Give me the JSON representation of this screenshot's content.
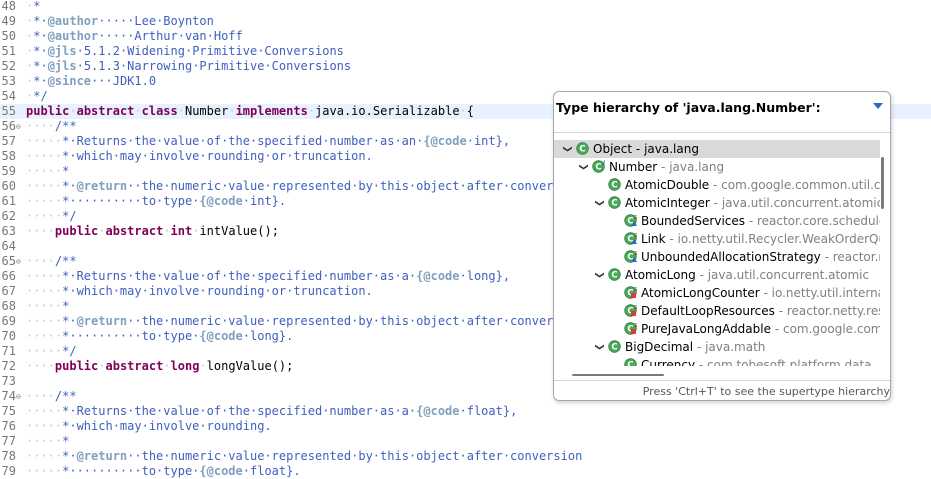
{
  "editor": {
    "lines": [
      {
        "n": "48",
        "t": " *"
      },
      {
        "n": "49",
        "t": " * @author     Lee Boynton"
      },
      {
        "n": "50",
        "t": " * @author     Arthur van Hoff"
      },
      {
        "n": "51",
        "t": " * @jls 5.1.2 Widening Primitive Conversions"
      },
      {
        "n": "52",
        "t": " * @jls 5.1.3 Narrowing Primitive Conversions"
      },
      {
        "n": "53",
        "t": " * @since   JDK1.0"
      },
      {
        "n": "54",
        "t": " */"
      },
      {
        "n": "55",
        "t": "public abstract class Number implements java.io.Serializable {"
      },
      {
        "n": "56",
        "t": "    /**"
      },
      {
        "n": "57",
        "t": "     * Returns the value of the specified number as an {@code int},"
      },
      {
        "n": "58",
        "t": "     * which may involve rounding or truncation."
      },
      {
        "n": "59",
        "t": "     *"
      },
      {
        "n": "60",
        "t": "     * @return  the numeric value represented by this object after conversion"
      },
      {
        "n": "61",
        "t": "     *          to type {@code int}."
      },
      {
        "n": "62",
        "t": "     */"
      },
      {
        "n": "63",
        "t": "    public abstract int intValue();"
      },
      {
        "n": "64",
        "t": ""
      },
      {
        "n": "65",
        "t": "    /**"
      },
      {
        "n": "66",
        "t": "     * Returns the value of the specified number as a {@code long},"
      },
      {
        "n": "67",
        "t": "     * which may involve rounding or truncation."
      },
      {
        "n": "68",
        "t": "     *"
      },
      {
        "n": "69",
        "t": "     * @return  the numeric value represented by this object after conversion"
      },
      {
        "n": "70",
        "t": "     *          to type {@code long}."
      },
      {
        "n": "71",
        "t": "     */"
      },
      {
        "n": "72",
        "t": "    public abstract long longValue();"
      },
      {
        "n": "73",
        "t": ""
      },
      {
        "n": "74",
        "t": "    /**"
      },
      {
        "n": "75",
        "t": "     * Returns the value of the specified number as a {@code float},"
      },
      {
        "n": "76",
        "t": "     * which may involve rounding."
      },
      {
        "n": "77",
        "t": "     *"
      },
      {
        "n": "78",
        "t": "     * @return  the numeric value represented by this object after conversion"
      },
      {
        "n": "79",
        "t": "     *          to type {@code float}."
      }
    ]
  },
  "hierarchy": {
    "title": "Type hierarchy of 'java.lang.Number':",
    "footer": "Press 'Ctrl+T' to see the supertype hierarchy",
    "items": [
      {
        "name": "Object",
        "pkg": "java.lang",
        "level": 0,
        "toggle": "expanded",
        "icon": "class-icon",
        "selected": true
      },
      {
        "name": "Number",
        "pkg": "java.lang",
        "level": 1,
        "toggle": "expanded",
        "icon": "abstract-class-icon"
      },
      {
        "name": "AtomicDouble",
        "pkg": "com.google.common.util.concurrent",
        "level": 2,
        "toggle": "none",
        "icon": "class-icon"
      },
      {
        "name": "AtomicInteger",
        "pkg": "java.util.concurrent.atomic",
        "level": 2,
        "toggle": "expanded",
        "icon": "class-icon"
      },
      {
        "name": "BoundedServices",
        "pkg": "reactor.core.scheduler",
        "level": 3,
        "toggle": "none",
        "icon": "static-final-class-icon"
      },
      {
        "name": "Link",
        "pkg": "io.netty.util.Recycler.WeakOrderQueue",
        "level": 3,
        "toggle": "none",
        "icon": "static-final-class-icon"
      },
      {
        "name": "UnboundedAllocationStrategy",
        "pkg": "reactor.netty.resources",
        "level": 3,
        "toggle": "none",
        "icon": "static-final-class-icon"
      },
      {
        "name": "AtomicLong",
        "pkg": "java.util.concurrent.atomic",
        "level": 2,
        "toggle": "expanded",
        "icon": "class-icon"
      },
      {
        "name": "AtomicLongCounter",
        "pkg": "io.netty.util.internal",
        "level": 3,
        "toggle": "none",
        "icon": "private-static-final-class-icon"
      },
      {
        "name": "DefaultLoopResources",
        "pkg": "reactor.netty.resources",
        "level": 3,
        "toggle": "none",
        "icon": "private-static-final-class-icon"
      },
      {
        "name": "PureJavaLongAddable",
        "pkg": "com.google.common.cache",
        "level": 3,
        "toggle": "none",
        "icon": "private-static-final-class-icon"
      },
      {
        "name": "BigDecimal",
        "pkg": "java.math",
        "level": 2,
        "toggle": "expanded",
        "icon": "class-icon"
      },
      {
        "name": "Currency",
        "pkg": "com.tobesoft.platform.data",
        "level": 3,
        "toggle": "none",
        "icon": "class-icon"
      }
    ]
  },
  "colors": {
    "keyword": "#7f0055",
    "comment": "#3f7f5f",
    "javadoc": "#3f5fbf",
    "javadoc_tag": "#7f9fbf",
    "class_icon": "#4aa85c",
    "package_text": "#808080",
    "selection": "#d9d9d9"
  }
}
